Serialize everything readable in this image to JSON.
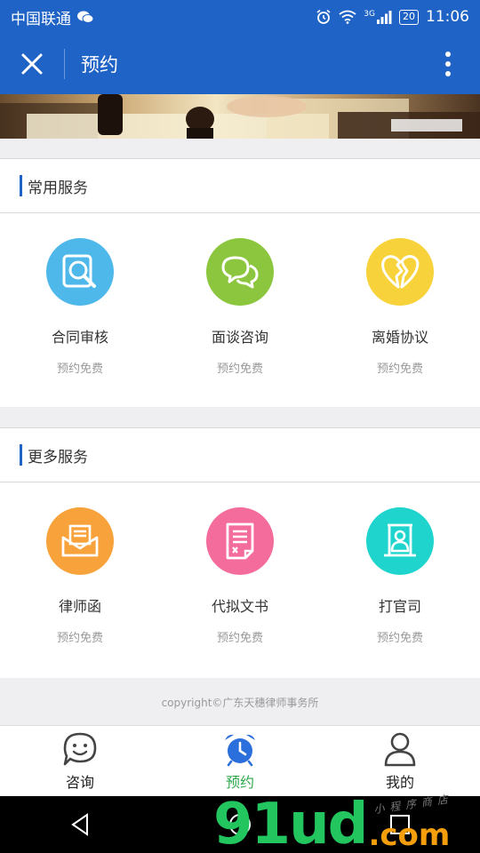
{
  "status_bar": {
    "carrier": "中国联通",
    "network": "3G",
    "battery": "20",
    "time": "11:06"
  },
  "app_bar": {
    "title": "预约"
  },
  "sections": [
    {
      "title": "常用服务",
      "items": [
        {
          "name": "合同审核",
          "sub": "预约免费",
          "color": "#4fb8ea",
          "icon": "magnifier-document-icon"
        },
        {
          "name": "面谈咨询",
          "sub": "预约免费",
          "color": "#8cc63f",
          "icon": "chat-bubbles-icon"
        },
        {
          "name": "离婚协议",
          "sub": "预约免费",
          "color": "#f8d23a",
          "icon": "broken-heart-icon"
        }
      ]
    },
    {
      "title": "更多服务",
      "items": [
        {
          "name": "律师函",
          "sub": "预约免费",
          "color": "#f7a23b",
          "icon": "envelope-letter-icon"
        },
        {
          "name": "代拟文书",
          "sub": "预约免费",
          "color": "#f46c9c",
          "icon": "document-icon"
        },
        {
          "name": "打官司",
          "sub": "预约免费",
          "color": "#1ed4cc",
          "icon": "courtroom-person-icon"
        }
      ]
    }
  ],
  "copyright": "copyright©广东天穗律师事务所",
  "tabs": [
    {
      "label": "咨询",
      "icon": "smile-chat-icon",
      "active": false
    },
    {
      "label": "预约",
      "icon": "alarm-clock-icon",
      "active": true
    },
    {
      "label": "我的",
      "icon": "person-icon",
      "active": false
    }
  ],
  "watermark": {
    "main": "91ud",
    "suffix": ".com",
    "tagline": "小程序商店"
  },
  "colors": {
    "primary": "#1f63c6",
    "active_tab": "#2fa84b",
    "accent_blue": "#2a6fdb"
  }
}
